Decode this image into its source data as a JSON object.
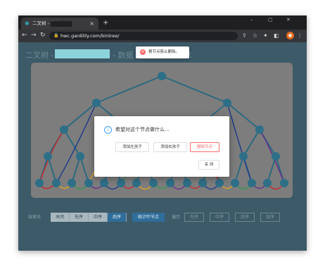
{
  "browser": {
    "tab_title": "二叉树 - 节点",
    "tab_close": "×",
    "new_tab": "+",
    "url": "hwc.gardilily.com/bintree/",
    "window_controls": [
      "–",
      "▢",
      "✕"
    ]
  },
  "page": {
    "title_prefix": "二叉树 -",
    "title_suffix": "- 数据",
    "title_tail": "术"
  },
  "toast": {
    "message": "根节点禁止删除。",
    "type": "error"
  },
  "dialog": {
    "question": "希望对这个节点做什么...",
    "buttons": [
      "添加左孩子",
      "添加右孩子",
      "删除节点"
    ],
    "close": "关 闭"
  },
  "controls": {
    "linearize_label": "线索化",
    "linearize_options": [
      "关闭",
      "先序",
      "中序",
      "后序"
    ],
    "linearize_selected": "后序",
    "count_leaves": "统计叶节点",
    "traverse_label": "遍历",
    "traverse_options": [
      "先序",
      "中序",
      "后序",
      "层序"
    ]
  },
  "colors": {
    "node": "#2e6f88",
    "edge": "#2a6a80",
    "thread_colors": [
      "#c7262b",
      "#e0a21e",
      "#2f9a52",
      "#6a2c8e",
      "#1b3a8a"
    ],
    "danger": "#f56c6c",
    "primary": "#2f6d9a"
  },
  "tree": {
    "levels": 6,
    "leaf_count": 16
  }
}
